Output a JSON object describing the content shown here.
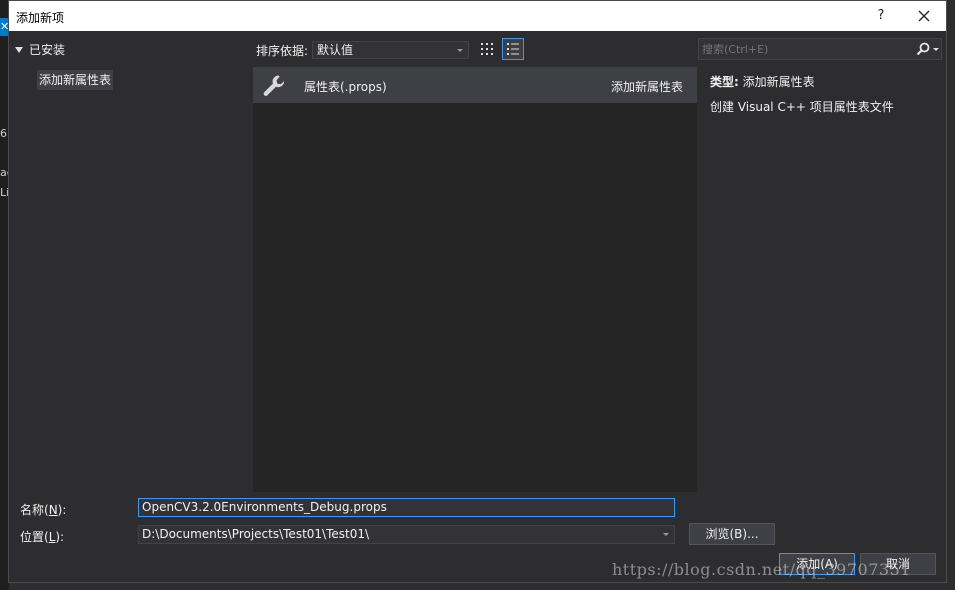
{
  "background_window": {
    "fragments": [
      "6",
      "ac",
      "Li"
    ]
  },
  "dialog": {
    "title": "添加新项",
    "help_label": "?"
  },
  "left_pane": {
    "root_label": "已安装",
    "items": [
      {
        "label": "添加新属性表",
        "selected": true
      }
    ]
  },
  "sortbar": {
    "label": "排序依据:",
    "value": "默认值"
  },
  "templates": [
    {
      "name": "属性表(.props)",
      "category": "添加新属性表",
      "icon": "wrench-icon"
    }
  ],
  "search": {
    "placeholder": "搜索(Ctrl+E)"
  },
  "description": {
    "type_label": "类型:",
    "type_value": "添加新属性表",
    "text": "创建 Visual C++ 项目属性表文件"
  },
  "form": {
    "name_label_prefix": "名称(",
    "name_label_key": "N",
    "name_label_suffix": "):",
    "name_value": "OpenCV3.2.0Environments_Debug.props",
    "location_label_prefix": "位置(",
    "location_label_key": "L",
    "location_label_suffix": "):",
    "location_value": "D:\\Documents\\Projects\\Test01\\Test01\\"
  },
  "buttons": {
    "browse": "浏览(B)...",
    "add": "添加(A)",
    "cancel": "取消"
  },
  "watermark": "https://blog.csdn.net/qq_39707351",
  "colors": {
    "dialog_bg": "#2d2d30",
    "pane_bg": "#252526",
    "selection": "#3f3f46",
    "accent": "#3399ff"
  }
}
